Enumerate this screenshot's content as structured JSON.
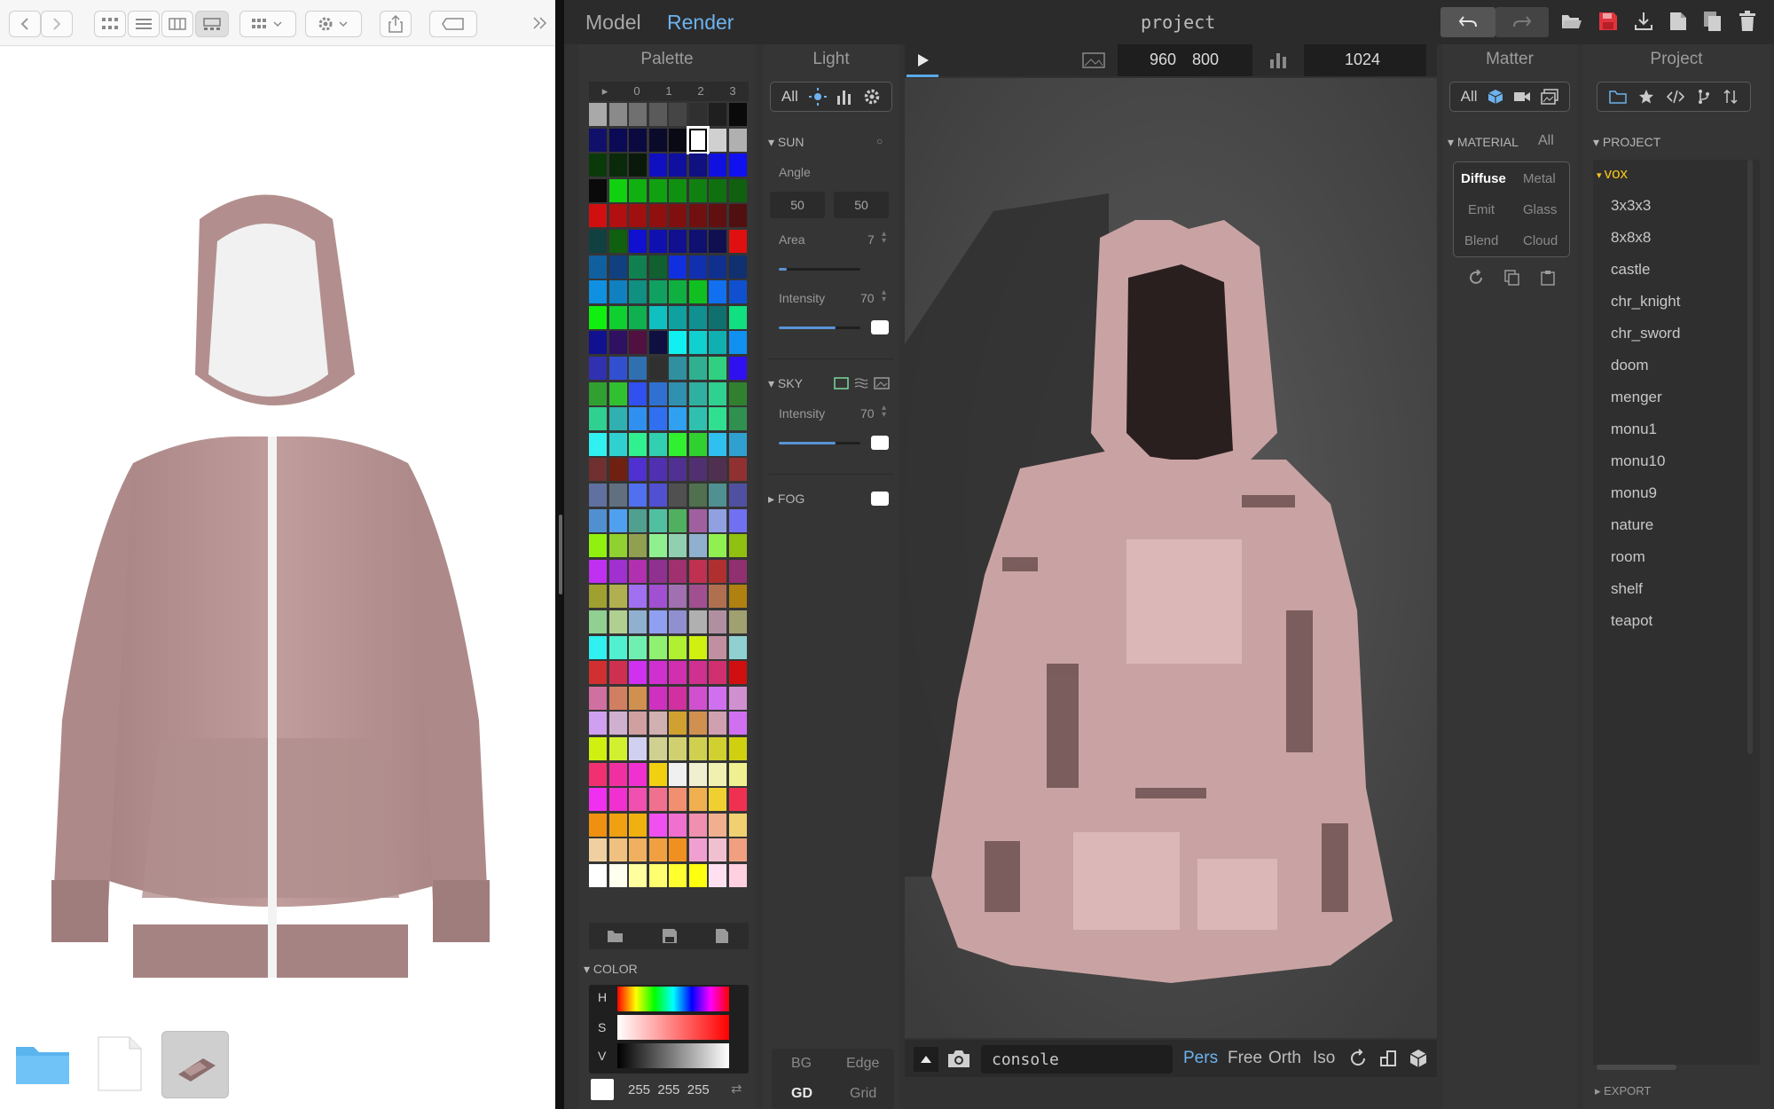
{
  "finder": {
    "thumbnails": [
      {
        "name": "folder-icon"
      },
      {
        "name": "document-icon"
      },
      {
        "name": "model-thumbnail"
      }
    ]
  },
  "app": {
    "mode_tabs": [
      {
        "label": "Model",
        "active": false
      },
      {
        "label": "Render",
        "active": true
      }
    ],
    "project_title": "project"
  },
  "palette": {
    "title": "Palette",
    "tabs": [
      "▸",
      "0",
      "1",
      "2",
      "3"
    ]
  },
  "light": {
    "title": "Light",
    "filter_all": "All",
    "sun": {
      "label": "SUN",
      "angle_label": "Angle",
      "angle_values": [
        "50",
        "50"
      ],
      "area_label": "Area",
      "area_value": "7",
      "area_level": 0.1,
      "intensity_label": "Intensity",
      "intensity_value": "70",
      "intensity_level": 0.7
    },
    "sky": {
      "label": "SKY",
      "intensity_label": "Intensity",
      "intensity_value": "70",
      "intensity_level": 0.7
    },
    "fog": {
      "label": "FOG"
    },
    "render_modes": [
      "BG",
      "Edge",
      "GD",
      "Grid"
    ]
  },
  "viewport": {
    "width": "960",
    "height": "800",
    "samples": "1024",
    "console_placeholder": "console",
    "camera_modes": [
      {
        "label": "Pers",
        "active": true
      },
      {
        "label": "Free",
        "active": false
      },
      {
        "label": "Orth",
        "active": false
      },
      {
        "label": "Iso",
        "active": false
      }
    ]
  },
  "matter": {
    "title": "Matter",
    "filter_all": "All",
    "material_label": "MATERIAL",
    "material_all": "All",
    "materials": [
      "Diffuse",
      "Metal",
      "Emit",
      "Glass",
      "Blend",
      "Cloud"
    ],
    "active_material": "Diffuse"
  },
  "project": {
    "title": "Project",
    "section_label": "PROJECT",
    "folder": "vox",
    "files": [
      "3x3x3",
      "8x8x8",
      "castle",
      "chr_knight",
      "chr_sword",
      "doom",
      "menger",
      "monu1",
      "monu10",
      "monu9",
      "nature",
      "room",
      "shelf",
      "teapot"
    ],
    "export_label": "EXPORT"
  },
  "color": {
    "label": "COLOR",
    "channels": [
      "H",
      "S",
      "V"
    ],
    "rgb": "255  255  255"
  },
  "colors": {
    "accent": "#5aa9e6",
    "save_red": "#e0343d",
    "folder_yellow": "#f5c518",
    "voxel_pink": "#c9a3a3",
    "hoodie": "#b89594"
  }
}
